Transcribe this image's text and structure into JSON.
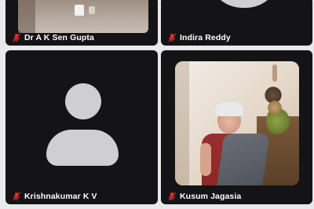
{
  "participants": [
    {
      "name": "Dr A K Sen Gupta",
      "muted": true,
      "view": "video"
    },
    {
      "name": "Indira Reddy",
      "muted": true,
      "view": "avatar"
    },
    {
      "name": "Krishnakumar K V",
      "muted": true,
      "view": "avatar"
    },
    {
      "name": "Kusum Jagasia",
      "muted": true,
      "view": "video"
    }
  ],
  "colors": {
    "tile_bg": "#141416",
    "page_bg": "#e9e9ec",
    "muted_icon": "#e0312e",
    "avatar_placeholder": "#cfcfd2",
    "label_text": "#ffffff"
  },
  "icons": {
    "muted": "mic-off-icon",
    "avatar": "person-placeholder-icon"
  }
}
